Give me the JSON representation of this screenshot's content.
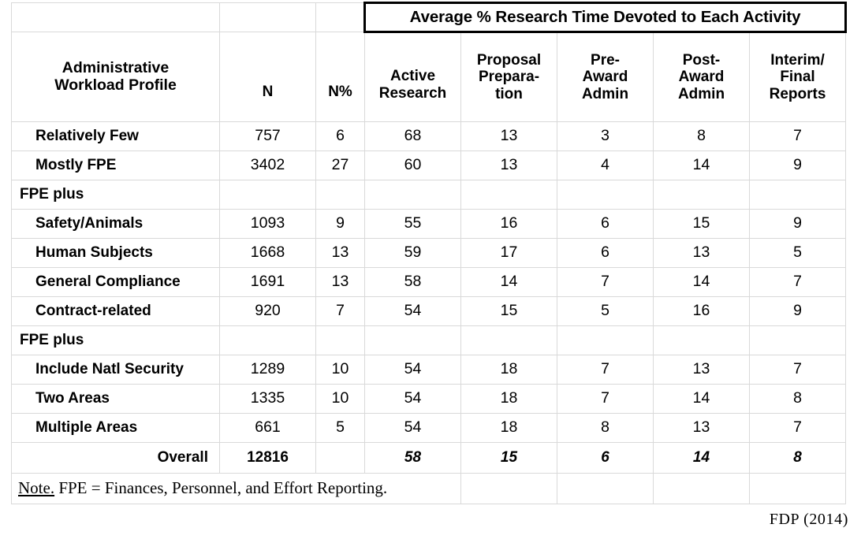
{
  "table": {
    "spanning_header": "Average % Research Time Devoted to Each Activity",
    "columns": {
      "profile": "Administrative\nWorkload Profile",
      "profile_line1": "Administrative",
      "profile_line2": "Workload Profile",
      "n": "N",
      "n_pct": "N%",
      "active_research_line1": "Active",
      "active_research_line2": "Research",
      "proposal_prep_line1": "Proposal",
      "proposal_prep_line2": "Prepara-",
      "proposal_prep_line3": "tion",
      "pre_award_line1": "Pre-",
      "pre_award_line2": "Award",
      "pre_award_line3": "Admin",
      "post_award_line1": "Post-",
      "post_award_line2": "Award",
      "post_award_line3": "Admin",
      "interim_line1": "Interim/",
      "interim_line2": "Final",
      "interim_line3": "Reports"
    },
    "rows": [
      {
        "type": "data",
        "label": "Relatively Few",
        "n": "757",
        "n_pct": "6",
        "active_research": "68",
        "proposal_preparation": "13",
        "pre_award_admin": "3",
        "post_award_admin": "8",
        "interim_final_reports": "7"
      },
      {
        "type": "data",
        "label": "Mostly FPE",
        "n": "3402",
        "n_pct": "27",
        "active_research": "60",
        "proposal_preparation": "13",
        "pre_award_admin": "4",
        "post_award_admin": "14",
        "interim_final_reports": "9"
      },
      {
        "type": "group",
        "label": "FPE plus",
        "n": "",
        "n_pct": "",
        "active_research": "",
        "proposal_preparation": "",
        "pre_award_admin": "",
        "post_award_admin": "",
        "interim_final_reports": ""
      },
      {
        "type": "data",
        "label": "Safety/Animals",
        "n": "1093",
        "n_pct": "9",
        "active_research": "55",
        "proposal_preparation": "16",
        "pre_award_admin": "6",
        "post_award_admin": "15",
        "interim_final_reports": "9"
      },
      {
        "type": "data",
        "label": "Human Subjects",
        "n": "1668",
        "n_pct": "13",
        "active_research": "59",
        "proposal_preparation": "17",
        "pre_award_admin": "6",
        "post_award_admin": "13",
        "interim_final_reports": "5"
      },
      {
        "type": "data",
        "label": "General Compliance",
        "n": "1691",
        "n_pct": "13",
        "active_research": "58",
        "proposal_preparation": "14",
        "pre_award_admin": "7",
        "post_award_admin": "14",
        "interim_final_reports": "7"
      },
      {
        "type": "data",
        "label": "Contract-related",
        "n": "920",
        "n_pct": "7",
        "active_research": "54",
        "proposal_preparation": "15",
        "pre_award_admin": "5",
        "post_award_admin": "16",
        "interim_final_reports": "9"
      },
      {
        "type": "group",
        "label": "FPE plus",
        "n": "",
        "n_pct": "",
        "active_research": "",
        "proposal_preparation": "",
        "pre_award_admin": "",
        "post_award_admin": "",
        "interim_final_reports": ""
      },
      {
        "type": "data",
        "label": "Include Natl Security",
        "n": "1289",
        "n_pct": "10",
        "active_research": "54",
        "proposal_preparation": "18",
        "pre_award_admin": "7",
        "post_award_admin": "13",
        "interim_final_reports": "7"
      },
      {
        "type": "data",
        "label": "Two Areas",
        "n": "1335",
        "n_pct": "10",
        "active_research": "54",
        "proposal_preparation": "18",
        "pre_award_admin": "7",
        "post_award_admin": "14",
        "interim_final_reports": "8"
      },
      {
        "type": "data",
        "label": "Multiple Areas",
        "n": "661",
        "n_pct": "5",
        "active_research": "54",
        "proposal_preparation": "18",
        "pre_award_admin": "8",
        "post_award_admin": "13",
        "interim_final_reports": "7"
      }
    ],
    "overall": {
      "label": "Overall",
      "n": "12816",
      "n_pct": "",
      "active_research": "58",
      "proposal_preparation": "15",
      "pre_award_admin": "6",
      "post_award_admin": "14",
      "interim_final_reports": "8"
    },
    "note_lead": "Note.",
    "note_text": " FPE = Finances, Personnel, and Effort Reporting."
  },
  "credit": "FDP (2014)",
  "chart_data": {
    "type": "table",
    "title": "Average % Research Time Devoted to Each Activity",
    "categories": [
      "Relatively Few",
      "Mostly FPE",
      "Safety/Animals",
      "Human Subjects",
      "General Compliance",
      "Contract-related",
      "Include Natl Security",
      "Two Areas",
      "Multiple Areas",
      "Overall"
    ],
    "columns": [
      "N",
      "N%",
      "Active Research",
      "Proposal Preparation",
      "Pre-Award Admin",
      "Post-Award Admin",
      "Interim/Final Reports"
    ],
    "series": [
      {
        "name": "N",
        "values": [
          757,
          3402,
          1093,
          1668,
          1691,
          920,
          1289,
          1335,
          661,
          12816
        ]
      },
      {
        "name": "N%",
        "values": [
          6,
          27,
          9,
          13,
          13,
          7,
          10,
          10,
          5,
          null
        ]
      },
      {
        "name": "Active Research",
        "values": [
          68,
          60,
          55,
          59,
          58,
          54,
          54,
          54,
          54,
          58
        ]
      },
      {
        "name": "Proposal Preparation",
        "values": [
          13,
          13,
          16,
          17,
          14,
          15,
          18,
          18,
          18,
          15
        ]
      },
      {
        "name": "Pre-Award Admin",
        "values": [
          3,
          4,
          6,
          6,
          7,
          5,
          7,
          7,
          8,
          6
        ]
      },
      {
        "name": "Post-Award Admin",
        "values": [
          8,
          14,
          15,
          13,
          14,
          16,
          13,
          14,
          13,
          14
        ]
      },
      {
        "name": "Interim/Final Reports",
        "values": [
          7,
          9,
          9,
          5,
          7,
          9,
          7,
          8,
          7,
          8
        ]
      }
    ]
  }
}
